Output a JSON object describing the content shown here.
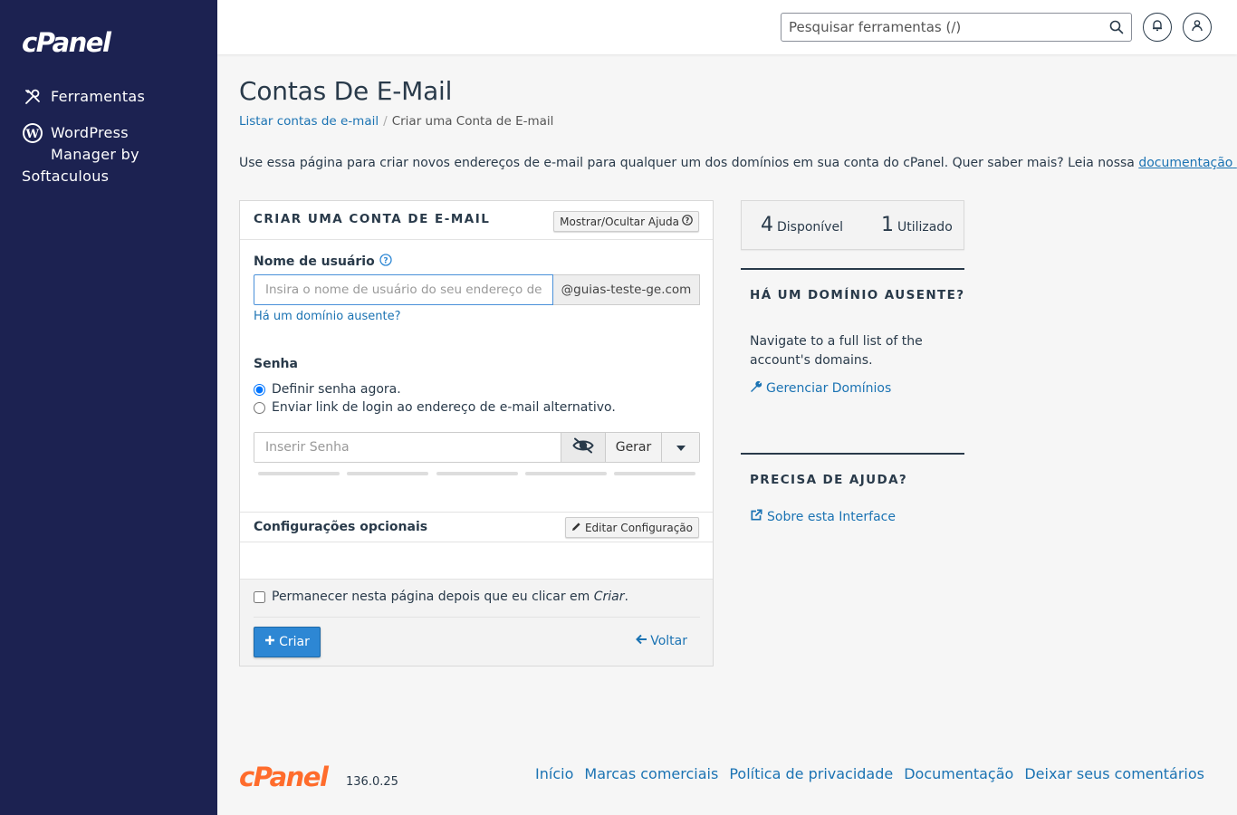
{
  "sidebar": {
    "logo": "cPanel",
    "items": [
      {
        "label": "Ferramentas",
        "icon": "tools-icon"
      },
      {
        "label_line1": "WordPress",
        "label_line2": "Manager by",
        "label_line3": "Softaculous",
        "icon": "wordpress-icon"
      }
    ]
  },
  "header": {
    "search_placeholder": "Pesquisar ferramentas (/)"
  },
  "page": {
    "title": "Contas De E-Mail",
    "breadcrumb": [
      {
        "label": "Listar contas de e-mail"
      },
      {
        "label": "Criar uma Conta de E-mail"
      }
    ],
    "intro_text": "Use essa página para criar novos endereços de e-mail para qualquer um dos domínios em sua conta do cPanel. Quer saber mais? Leia nossa ",
    "intro_link": "documentação",
    "intro_suffix": " ."
  },
  "form": {
    "title": "CRIAR UMA CONTA DE E-MAIL",
    "help_button": "Mostrar/Ocultar Ajuda",
    "username_label": "Nome de usuário",
    "username_placeholder": "Insira o nome de usuário do seu endereço de e-mail.",
    "domain": "@guias-teste-ge.com",
    "missing_domain_link": "Há um domínio ausente?",
    "password_label": "Senha",
    "radio_set_now": "Definir senha agora.",
    "radio_send_link": "Enviar link de login ao endereço de e-mail alternativo.",
    "password_placeholder": "Inserir Senha",
    "generate_button": "Gerar",
    "optional_title": "Configurações opcionais",
    "edit_config_button": "Editar Configuração",
    "stay_text": "Permanecer nesta página depois que eu clicar em ",
    "stay_text_em": "Criar",
    "stay_text_end": ".",
    "create_button": "Criar",
    "back_link": "Voltar"
  },
  "stats": {
    "available_count": "4",
    "available_label": "Disponível",
    "used_count": "1",
    "used_label": "Utilizado"
  },
  "aside": {
    "missing_heading": "HÁ UM DOMÍNIO AUSENTE?",
    "missing_text": "Navigate to a full list of the account's domains.",
    "manage_link": "Gerenciar Domínios",
    "help_heading": "PRECISA DE AJUDA?",
    "about_link": "Sobre esta Interface"
  },
  "footer": {
    "logo": "cPanel",
    "version": "136.0.25",
    "links": [
      "Início",
      "Marcas comerciais",
      "Política de privacidade",
      "Documentação",
      "Deixar seus comentários"
    ]
  },
  "colors": {
    "sidebar_bg": "#1c2251",
    "primary_button": "#2d87d4",
    "link": "#1b73b3",
    "footer_logo": "#ff6c2c"
  }
}
